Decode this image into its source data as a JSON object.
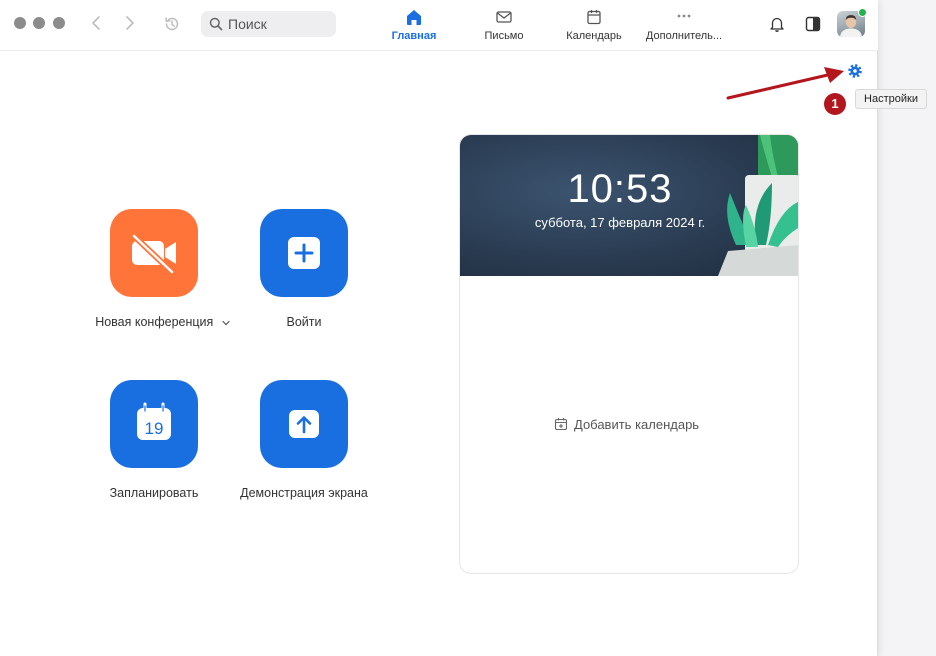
{
  "search": {
    "placeholder": "Поиск"
  },
  "tabs": [
    {
      "label": "Главная",
      "icon": "home-icon",
      "active": true
    },
    {
      "label": "Письмо",
      "icon": "mail-icon"
    },
    {
      "label": "Календарь",
      "icon": "calendar-icon"
    },
    {
      "label": "Дополнитель...",
      "icon": "more-icon"
    }
  ],
  "tooltip": {
    "settings": "Настройки"
  },
  "annotation": {
    "marker": "1"
  },
  "actions": {
    "new_meeting": "Новая конференция",
    "join": "Войти",
    "schedule": "Запланировать",
    "schedule_day": "19",
    "share_screen": "Демонстрация экрана"
  },
  "calendar_card": {
    "time": "10:53",
    "date": "суббота, 17 февраля 2024 г.",
    "add_calendar": "Добавить календарь"
  },
  "colors": {
    "accent_blue": "#1a6fe0",
    "orange": "#ff7438",
    "annotation_red": "#b3161d",
    "status_green": "#23b14d"
  }
}
